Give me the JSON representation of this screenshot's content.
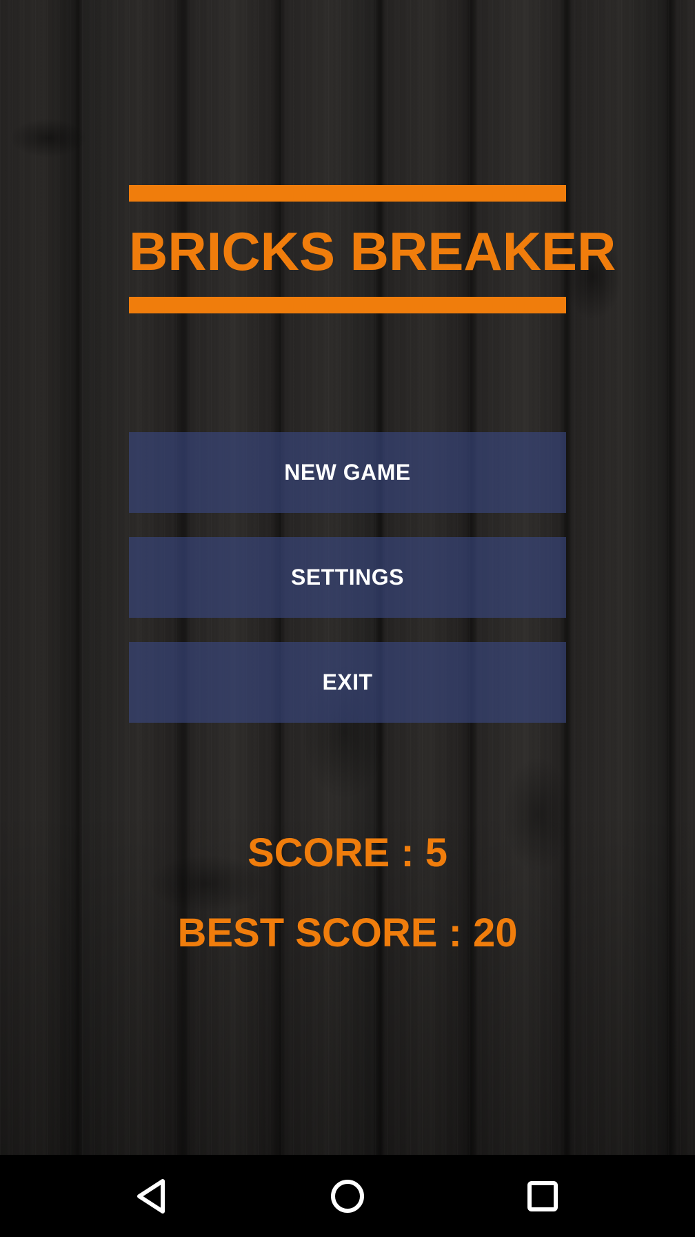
{
  "app": {
    "title": "BRICKS BREAKER"
  },
  "menu": {
    "new_game": "NEW GAME",
    "settings": "SETTINGS",
    "exit": "EXIT"
  },
  "scores": {
    "score_text": "SCORE : 5",
    "best_score_text": "BEST SCORE : 20",
    "score": 5,
    "best_score": 20
  },
  "navigation_bar": {
    "back_icon": "back-triangle-icon",
    "home_icon": "home-circle-icon",
    "recents_icon": "recents-square-icon"
  },
  "colors": {
    "accent": "#f07d0c",
    "button_bg": "#3a4882",
    "button_text": "#ffffff",
    "nav_bg": "#000000"
  }
}
